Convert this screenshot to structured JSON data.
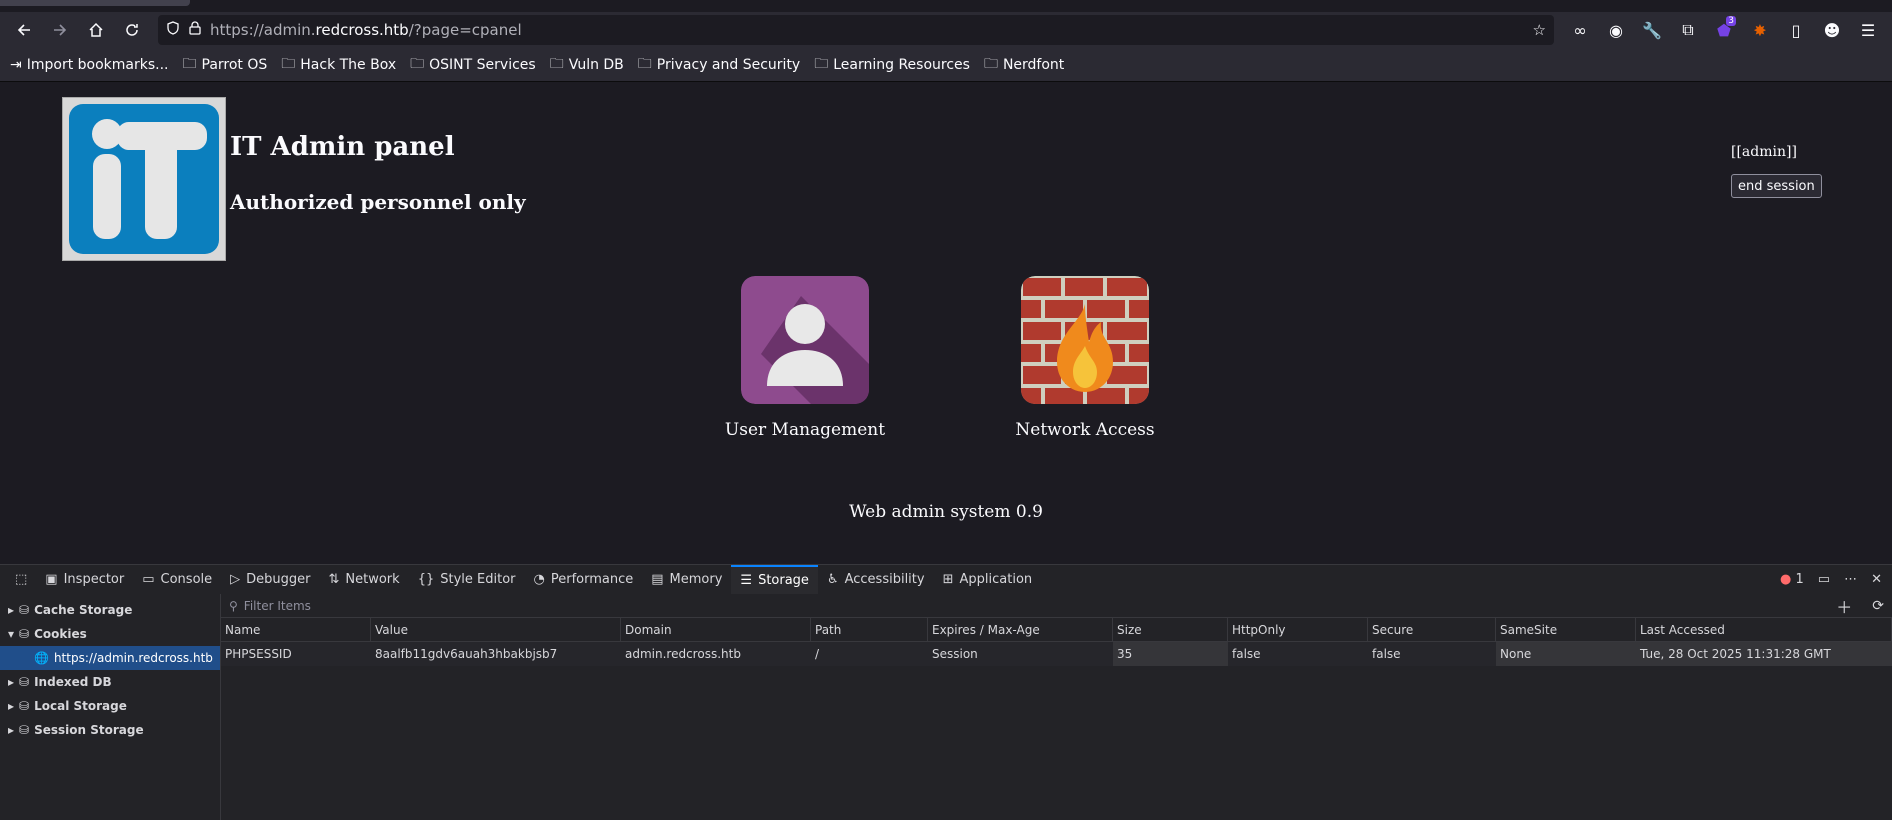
{
  "browser": {
    "url_scheme": "https://admin.",
    "url_host": "redcross.htb",
    "url_path": "/?page=cpanel",
    "extension_badge": "3",
    "bookmarks": [
      {
        "label": "Import bookmarks...",
        "icon": "import-icon"
      },
      {
        "label": "Parrot OS",
        "icon": "folder-icon"
      },
      {
        "label": "Hack The Box",
        "icon": "folder-icon"
      },
      {
        "label": "OSINT Services",
        "icon": "folder-icon"
      },
      {
        "label": "Vuln DB",
        "icon": "folder-icon"
      },
      {
        "label": "Privacy and Security",
        "icon": "folder-icon"
      },
      {
        "label": "Learning Resources",
        "icon": "folder-icon"
      },
      {
        "label": "Nerdfont",
        "icon": "folder-icon"
      }
    ]
  },
  "page": {
    "title": "IT Admin panel",
    "subtitle": "Authorized personnel only",
    "user": "[[admin]]",
    "end_session": "end session",
    "apps": [
      {
        "label": "User Management",
        "icon": "user-icon",
        "color": "#8e4b8e"
      },
      {
        "label": "Network Access",
        "icon": "firewall-icon",
        "color": "#b03a2e"
      }
    ],
    "footer": "Web admin system 0.9"
  },
  "devtools": {
    "tabs": [
      "Inspector",
      "Console",
      "Debugger",
      "Network",
      "Style Editor",
      "Performance",
      "Memory",
      "Storage",
      "Accessibility",
      "Application"
    ],
    "active_tab": "Storage",
    "error_count": "1",
    "sidebar": [
      "Cache Storage",
      "Cookies",
      "https://admin.redcross.htb",
      "Indexed DB",
      "Local Storage",
      "Session Storage"
    ],
    "filter_placeholder": "Filter Items",
    "columns": [
      "Name",
      "Value",
      "Domain",
      "Path",
      "Expires / Max-Age",
      "Size",
      "HttpOnly",
      "Secure",
      "SameSite",
      "Last Accessed"
    ],
    "rows": [
      [
        "PHPSESSID",
        "8aalfb11gdv6auah3hbakbjsb7",
        "admin.redcross.htb",
        "/",
        "Session",
        "35",
        "false",
        "false",
        "None",
        "Tue, 28 Oct 2025 11:31:28 GMT"
      ]
    ],
    "accent_color": "#0a84ff"
  }
}
